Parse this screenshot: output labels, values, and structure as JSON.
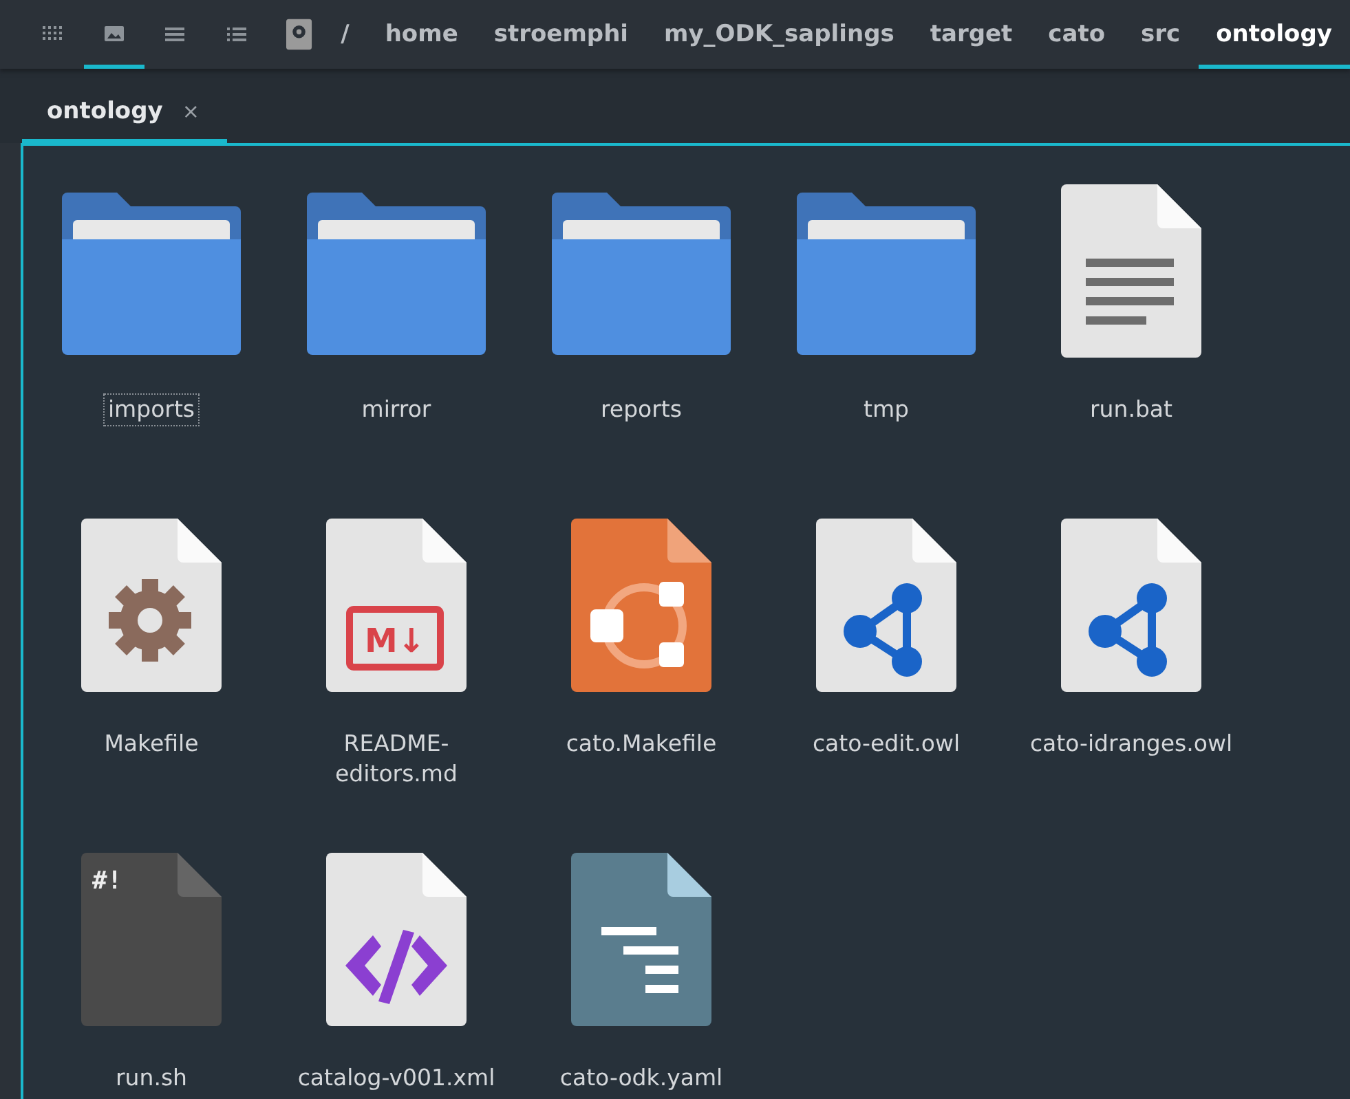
{
  "toolbar": {
    "view_buttons": [
      {
        "kind": "grid",
        "selected": false
      },
      {
        "kind": "image",
        "selected": true
      },
      {
        "kind": "lines",
        "selected": false
      },
      {
        "kind": "list",
        "selected": false
      }
    ],
    "breadcrumbs": [
      {
        "label": "/",
        "selected": false
      },
      {
        "label": "home",
        "selected": false
      },
      {
        "label": "stroemphi",
        "selected": false
      },
      {
        "label": "my_ODK_saplings",
        "selected": false
      },
      {
        "label": "target",
        "selected": false
      },
      {
        "label": "cato",
        "selected": false
      },
      {
        "label": "src",
        "selected": false
      },
      {
        "label": "ontology",
        "selected": true
      }
    ]
  },
  "tabs": [
    {
      "label": "ontology",
      "close": "×",
      "selected": true
    }
  ],
  "files": [
    {
      "name": "imports",
      "kind": "folder",
      "focused": true
    },
    {
      "name": "mirror",
      "kind": "folder",
      "focused": false
    },
    {
      "name": "reports",
      "kind": "folder",
      "focused": false
    },
    {
      "name": "tmp",
      "kind": "folder",
      "focused": false
    },
    {
      "name": "run.bat",
      "kind": "text",
      "focused": false
    },
    {
      "name": "Makefile",
      "kind": "makefile",
      "focused": false
    },
    {
      "name": "README-editors.md",
      "kind": "markdown",
      "badge": "M↓",
      "focused": false
    },
    {
      "name": "cato.Makefile",
      "kind": "cmake",
      "focused": false
    },
    {
      "name": "cato-edit.owl",
      "kind": "owl",
      "focused": false
    },
    {
      "name": "cato-idranges.owl",
      "kind": "owl",
      "focused": false
    },
    {
      "name": "run.sh",
      "kind": "script",
      "badge": "#!",
      "focused": false
    },
    {
      "name": "catalog-v001.xml",
      "kind": "xml",
      "focused": false
    },
    {
      "name": "cato-odk.yaml",
      "kind": "yaml",
      "focused": false
    }
  ]
}
